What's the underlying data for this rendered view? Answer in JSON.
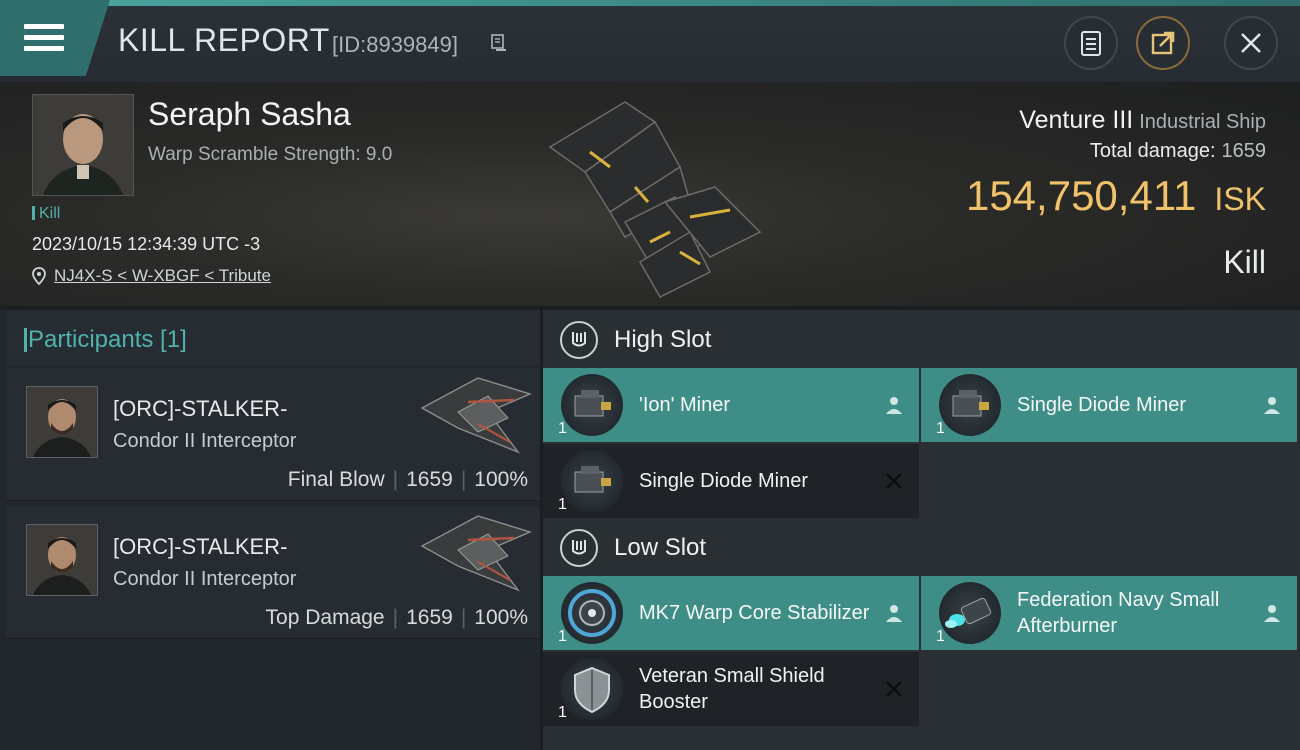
{
  "header": {
    "title": "KILL REPORT",
    "report_id": "[ID:8939849]"
  },
  "victim": {
    "name": "Seraph Sasha",
    "warp_scramble": "Warp Scramble Strength: 9.0",
    "tag": "Kill",
    "datetime": "2023/10/15 12:34:39 UTC -3",
    "location": "NJ4X-S < W-XBGF < Tribute",
    "ship_name": "Venture III",
    "ship_class": "Industrial Ship",
    "total_damage_label": "Total damage:",
    "total_damage": "1659",
    "isk_value": "154,750,411",
    "isk_unit": "ISK",
    "kill_type": "Kill"
  },
  "participants": {
    "title": "Participants [1]",
    "items": [
      {
        "name": "[ORC]-STALKER-",
        "ship": "Condor II Interceptor",
        "role": "Final Blow",
        "damage": "1659",
        "percent": "100%"
      },
      {
        "name": "[ORC]-STALKER-",
        "ship": "Condor II Interceptor",
        "role": "Top Damage",
        "damage": "1659",
        "percent": "100%"
      }
    ]
  },
  "slots": {
    "high": {
      "title": "High Slot",
      "modules": [
        {
          "name": "'Ion' Miner",
          "qty": "1",
          "status": "dropped"
        },
        {
          "name": "Single Diode Miner",
          "qty": "1",
          "status": "dropped"
        },
        {
          "name": "Single Diode Miner",
          "qty": "1",
          "status": "destroyed"
        }
      ]
    },
    "low": {
      "title": "Low Slot",
      "modules": [
        {
          "name": "MK7 Warp Core Stabilizer",
          "qty": "1",
          "status": "dropped"
        },
        {
          "name": "Federation Navy Small Afterburner",
          "qty": "1",
          "status": "dropped"
        },
        {
          "name": "Veteran Small Shield Booster",
          "qty": "1",
          "status": "destroyed"
        }
      ]
    }
  },
  "colors": {
    "accent": "#4fb3ac",
    "isk": "#f0c36b",
    "dropped_bg": "#3f8d87",
    "destroyed_bg": "#1f2327"
  }
}
